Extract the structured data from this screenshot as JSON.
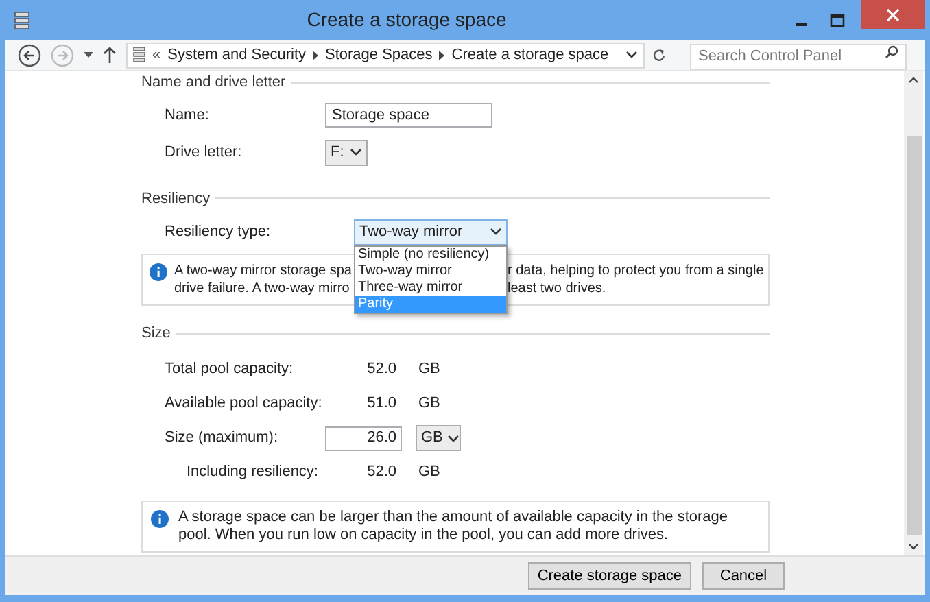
{
  "window": {
    "title": "Create a storage space"
  },
  "address_bar": {
    "prefix": "«",
    "breadcrumbs": [
      "System and Security",
      "Storage Spaces",
      "Create a storage space"
    ]
  },
  "search": {
    "placeholder": "Search Control Panel"
  },
  "name_section": {
    "heading": "Name and drive letter",
    "name_label": "Name:",
    "name_value": "Storage space",
    "drive_label": "Drive letter:",
    "drive_value": "F:"
  },
  "resiliency_section": {
    "heading": "Resiliency",
    "type_label": "Resiliency type:",
    "type_value": "Two-way mirror",
    "options": [
      {
        "label": "Simple (no resiliency)",
        "selected": false
      },
      {
        "label": "Two-way mirror",
        "selected": false
      },
      {
        "label": "Three-way mirror",
        "selected": false
      },
      {
        "label": "Parity",
        "selected": true
      }
    ],
    "info_lines": [
      {
        "left": "A two-way mirror storage spa",
        "right": "r data, helping to protect you from a single"
      },
      {
        "left": "drive failure. A two-way mirro",
        "right": "least two drives."
      }
    ]
  },
  "size_section": {
    "heading": "Size",
    "rows": [
      {
        "kind": "value",
        "label": "Total pool capacity:",
        "value": "52.0",
        "unit": "GB"
      },
      {
        "kind": "value",
        "label": "Available pool capacity:",
        "value": "51.0",
        "unit": "GB"
      },
      {
        "kind": "input",
        "label": "Size (maximum):",
        "value": "26.0",
        "unit": "GB"
      },
      {
        "kind": "sub",
        "label": "Including resiliency:",
        "value": "52.0",
        "unit": "GB"
      }
    ],
    "info": "A storage space can be larger than the amount of available capacity in the storage pool. When you run low on capacity in the pool, you can add more drives."
  },
  "buttons": [
    "Create storage space",
    "Cancel"
  ]
}
